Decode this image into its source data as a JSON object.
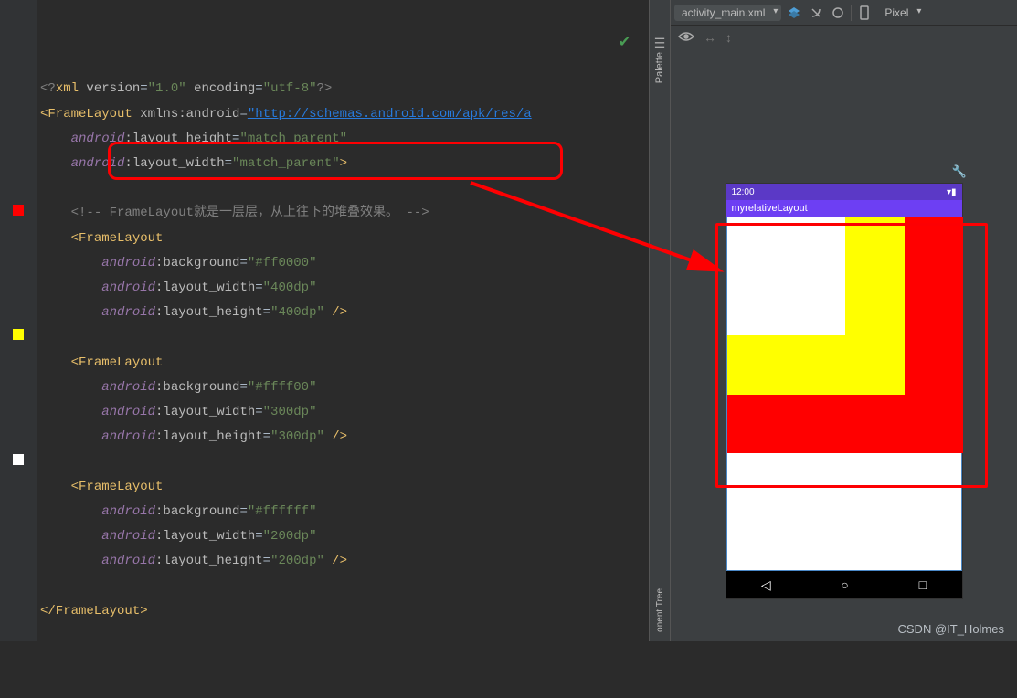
{
  "editor": {
    "xml_decl": {
      "open": "<?",
      "tag": "xml",
      "version_attr": " version",
      "version_val": "\"1.0\"",
      "encoding_attr": " encoding",
      "encoding_val": "\"utf-8\"",
      "close": "?>"
    },
    "root": {
      "open": "<",
      "tag": "FrameLayout",
      "xmlns_attr": " xmlns:android",
      "xmlns_val": "\"http://schemas.android.com/apk/res/a"
    },
    "root_h": {
      "ns": "android",
      "name": ":layout_height",
      "val": "\"match_parent\""
    },
    "root_w": {
      "ns": "android",
      "name": ":layout_width",
      "val": "\"match_parent\"",
      "close": ">"
    },
    "comment_open": "<!-- ",
    "comment_text": "FrameLayout就是一层层，从上往下的堆叠效果。 ",
    "comment_close": "-->",
    "frame1": {
      "open": "<FrameLayout",
      "bg": {
        "ns": "android",
        "name": ":background",
        "val": "\"#ff0000\""
      },
      "w": {
        "ns": "android",
        "name": ":layout_width",
        "val": "\"400dp\""
      },
      "h": {
        "ns": "android",
        "name": ":layout_height",
        "val": "\"400dp\"",
        "close": " />"
      }
    },
    "frame2": {
      "open": "<FrameLayout",
      "bg": {
        "ns": "android",
        "name": ":background",
        "val": "\"#ffff00\""
      },
      "w": {
        "ns": "android",
        "name": ":layout_width",
        "val": "\"300dp\""
      },
      "h": {
        "ns": "android",
        "name": ":layout_height",
        "val": "\"300dp\"",
        "close": " />"
      }
    },
    "frame3": {
      "open": "<FrameLayout",
      "bg": {
        "ns": "android",
        "name": ":background",
        "val": "\"#ffffff\""
      },
      "w": {
        "ns": "android",
        "name": ":layout_width",
        "val": "\"200dp\""
      },
      "h": {
        "ns": "android",
        "name": ":layout_height",
        "val": "\"200dp\"",
        "close": " />"
      }
    },
    "root_close": "</FrameLayout>"
  },
  "preview": {
    "file_dropdown": "activity_main.xml",
    "device_dropdown": "Pixel",
    "status_time": "12:00",
    "app_title": "myrelativeLayout"
  },
  "palette_label": "Palette",
  "tree_label": "onent Tree",
  "watermark": "CSDN @IT_Holmes"
}
